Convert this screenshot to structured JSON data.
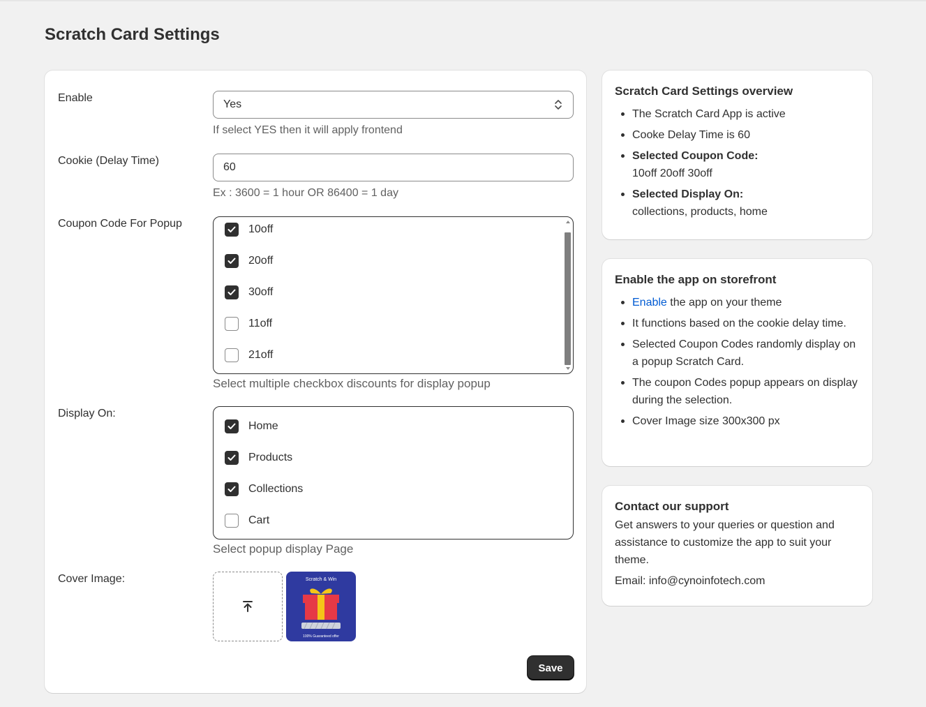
{
  "page_title": "Scratch Card Settings",
  "form": {
    "enable": {
      "label": "Enable",
      "value": "Yes",
      "help": "If select YES then it will apply frontend"
    },
    "cookie": {
      "label": "Cookie (Delay Time)",
      "value": "60",
      "help": "Ex : 3600 = 1 hour OR 86400 = 1 day"
    },
    "coupon": {
      "label": "Coupon Code For Popup",
      "options": [
        {
          "label": "10off",
          "checked": true
        },
        {
          "label": "20off",
          "checked": true
        },
        {
          "label": "30off",
          "checked": true
        },
        {
          "label": "11off",
          "checked": false
        },
        {
          "label": "21off",
          "checked": false
        }
      ],
      "help": "Select multiple checkbox discounts for display popup"
    },
    "display_on": {
      "label": "Display On:",
      "options": [
        {
          "label": "Home",
          "checked": true
        },
        {
          "label": "Products",
          "checked": true
        },
        {
          "label": "Collections",
          "checked": true
        },
        {
          "label": "Cart",
          "checked": false
        }
      ],
      "help": "Select popup display Page"
    },
    "cover_image": {
      "label": "Cover Image:",
      "thumb_title": "Scratch & Win",
      "thumb_caption": "100% Guaranteed offer"
    },
    "save_label": "Save"
  },
  "overview": {
    "title": "Scratch Card Settings overview",
    "items": {
      "active": "The Scratch Card App is active",
      "delay": "Cooke Delay Time is 60",
      "coupon_label": "Selected Coupon Code:",
      "coupon_value": "10off 20off 30off",
      "display_label": "Selected Display On:",
      "display_value": "collections, products, home"
    }
  },
  "storefront": {
    "title": "Enable the app on storefront",
    "enable_link": "Enable",
    "enable_rest": " the app on your theme",
    "items": [
      "It functions based on the cookie delay time.",
      "Selected Coupon Codes randomly display on a popup Scratch Card.",
      "The coupon Codes popup appears on display during the selection.",
      "Cover Image size 300x300 px"
    ]
  },
  "support": {
    "title": "Contact our support",
    "text": "Get answers to your queries or question and assistance to customize the app to suit your theme.",
    "email": "Email: info@cynoinfotech.com"
  },
  "colors": {
    "background": "#f1f1f1",
    "primary_button": "#303030",
    "link": "#005bd3"
  }
}
